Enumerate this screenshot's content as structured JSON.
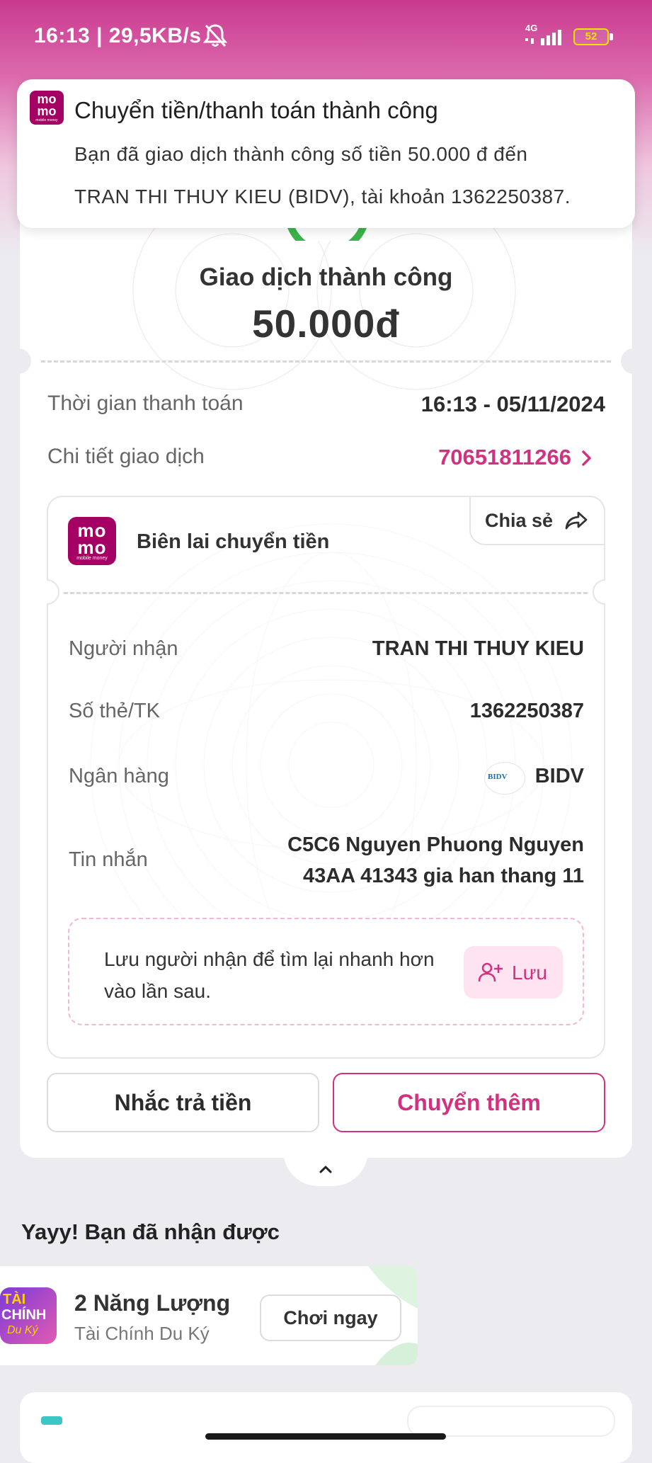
{
  "status_bar": {
    "time_speed": "16:13 | 29,5KB/s",
    "network": "4G",
    "battery": "52"
  },
  "notification": {
    "title": "Chuyển tiền/thanh toán thành công",
    "body_line1": "Bạn đã giao dịch thành công số tiền 50.000 đ đến",
    "body_line2": "TRAN THI THUY KIEU (BIDV), tài khoản 1362250387.",
    "logo_text": [
      "mo",
      "mo",
      "mobile money"
    ]
  },
  "result": {
    "title": "Giao dịch thành công",
    "amount": "50.000đ"
  },
  "details": {
    "time_label": "Thời gian thanh toán",
    "time_value": "16:13 - 05/11/2024",
    "txn_label": "Chi tiết giao dịch",
    "txn_value": "70651811266"
  },
  "receipt": {
    "title": "Biên lai chuyển tiền",
    "share_label": "Chia sẻ",
    "logo_text": [
      "mo",
      "mo",
      "mobile money"
    ],
    "rows": [
      {
        "label": "Người nhận",
        "value": "TRAN THI THUY KIEU"
      },
      {
        "label": "Số thẻ/TK",
        "value": "1362250387"
      },
      {
        "label": "Ngân hàng",
        "value": "BIDV"
      },
      {
        "label": "Tin nhắn",
        "value_line1": "C5C6 Nguyen Phuong Nguyen",
        "value_line2": "43AA 41343 gia han thang 11"
      }
    ],
    "bank_logo_text": "BIDV",
    "save_prompt": "Lưu người nhận để tìm lại nhanh hơn vào lần sau.",
    "save_label": "Lưu"
  },
  "actions": {
    "remind_label": "Nhắc trả tiền",
    "transfer_more_label": "Chuyển thêm"
  },
  "rewards": {
    "title": "Yayy! Bạn đã nhận được",
    "item_title": "2 Năng Lượng",
    "item_sub": "Tài Chính Du Ký",
    "play_label": "Chơi ngay",
    "game_logo_text": [
      "TÀI",
      "CHÍNH",
      "Du Ký"
    ]
  },
  "colors": {
    "brand": "#a50064",
    "accent": "#d2317f",
    "success": "#3cb54a"
  }
}
